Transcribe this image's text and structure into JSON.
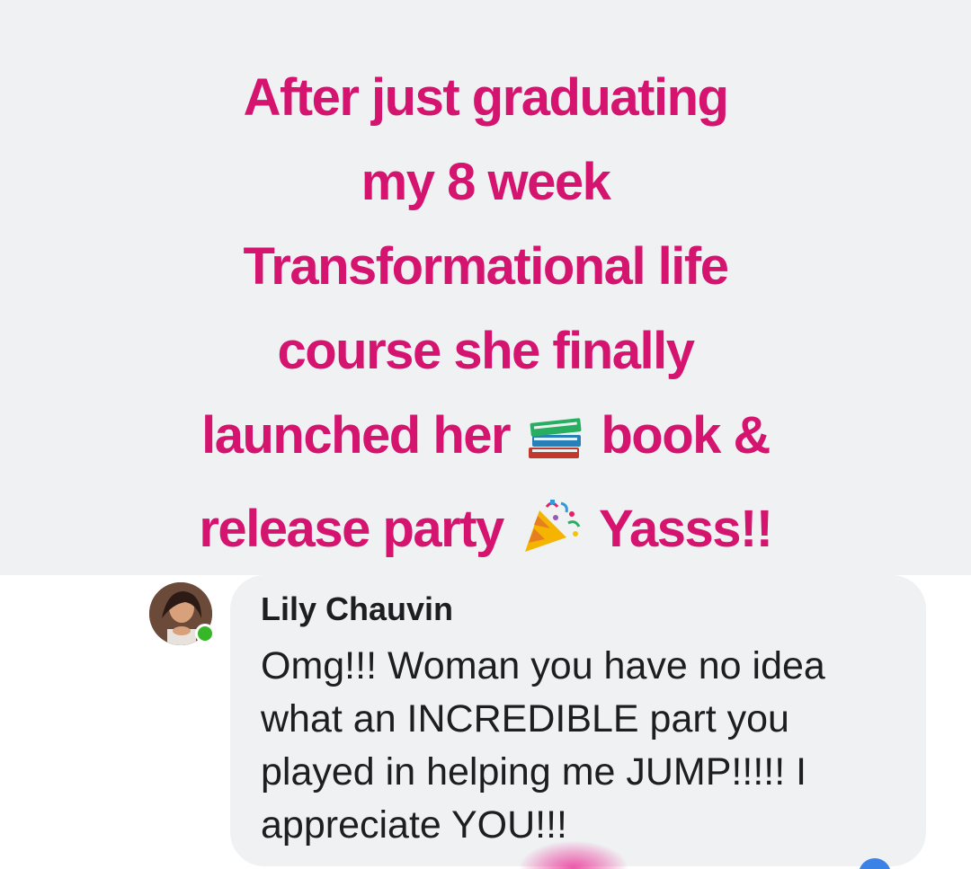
{
  "post": {
    "headline_lines": [
      "After just graduating",
      "my 8 week",
      "Transformational life",
      "course she finally"
    ],
    "line5_before": "launched her",
    "line5_emoji": "books-emoji",
    "line5_after": "book &",
    "line6_before": "release party",
    "line6_emoji": "party-popper-emoji",
    "line6_after": "Yasss!!",
    "text_color": "#d4146f",
    "background_color": "#eff1f3"
  },
  "comment": {
    "author": "Lily Chauvin",
    "text": "Omg!!! Woman you have no idea what an INCREDIBLE part you played in helping me JUMP!!!!! I appreciate YOU!!!",
    "online_status_color": "#35b728",
    "bubble_color": "#eff1f3"
  }
}
